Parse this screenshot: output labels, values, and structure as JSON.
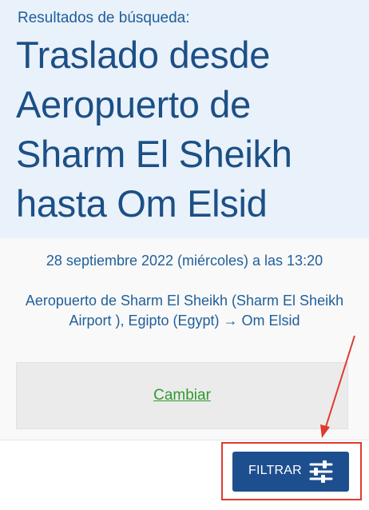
{
  "header": {
    "results_label": "Resultados de búsqueda:",
    "title": "Traslado desde Aeropuerto de Sharm El Sheikh hasta Om Elsid"
  },
  "trip": {
    "date_time": "28 septiembre 2022 (miércoles) a las 13:20",
    "route": "Aeropuerto de Sharm El Sheikh (Sharm El Sheikh Airport ), Egipto (Egypt) → Om Elsid"
  },
  "actions": {
    "change_label": "Cambiar",
    "filter_label": "FILTRAR"
  },
  "colors": {
    "title": "#1c4f86",
    "text": "#1f5f9a",
    "link": "#2f9a2f",
    "button": "#1d4f8f",
    "annotation": "#e03a2e"
  }
}
